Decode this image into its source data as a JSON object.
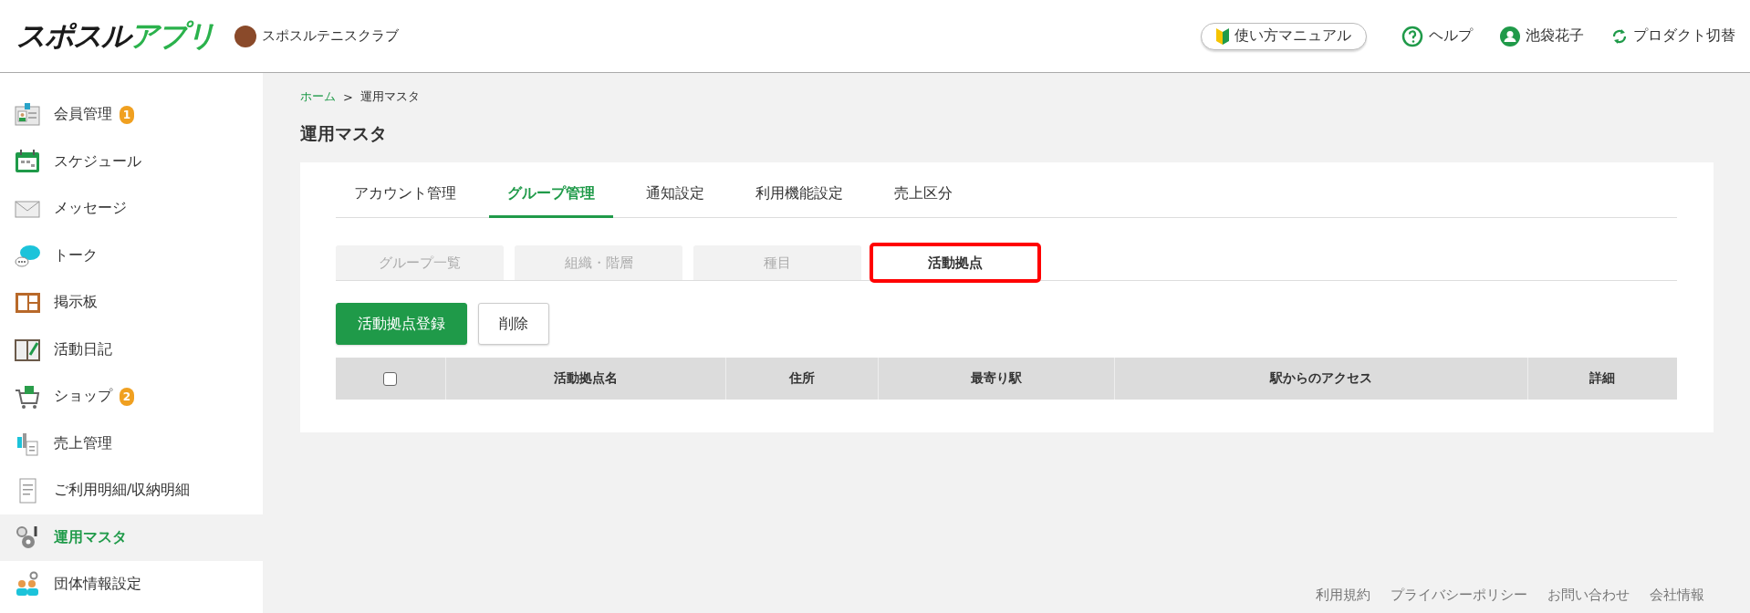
{
  "header": {
    "logo": {
      "part_1": "スポスル",
      "part_2": "アプリ"
    },
    "club_name": "スポスルテニスクラブ",
    "manual_button": "使い方マニュアル",
    "help": "ヘルプ",
    "user_name": "池袋花子",
    "product_switch": "プロダクト切替"
  },
  "sidebar": {
    "items": [
      {
        "kind": "member",
        "label": "会員管理",
        "badge": "1",
        "selected": false
      },
      {
        "kind": "calendar",
        "label": "スケジュール",
        "selected": false
      },
      {
        "kind": "mail",
        "label": "メッセージ",
        "selected": false
      },
      {
        "kind": "chat",
        "label": "トーク",
        "selected": false
      },
      {
        "kind": "board",
        "label": "掲示板",
        "selected": false
      },
      {
        "kind": "diary",
        "label": "活動日記",
        "selected": false
      },
      {
        "kind": "cart",
        "label": "ショップ",
        "badge": "2",
        "selected": false
      },
      {
        "kind": "sales",
        "label": "売上管理",
        "selected": false
      },
      {
        "kind": "receipt",
        "label": "ご利用明細/収納明細",
        "selected": false
      },
      {
        "kind": "gears",
        "label": "運用マスタ",
        "selected": true
      },
      {
        "kind": "team",
        "label": "団体情報設定",
        "selected": false
      }
    ]
  },
  "breadcrumb": [
    {
      "label": "ホーム",
      "link": true
    },
    {
      "label": ">",
      "link": false
    },
    {
      "label": "運用マスタ",
      "link": false
    }
  ],
  "page_title": "運用マスタ",
  "tabs": [
    {
      "label": "アカウント管理",
      "selected": false
    },
    {
      "label": "グループ管理",
      "selected": true
    },
    {
      "label": "通知設定",
      "selected": false
    },
    {
      "label": "利用機能設定",
      "selected": false
    },
    {
      "label": "売上区分",
      "selected": false
    }
  ],
  "subtabs": [
    {
      "label": "グループ一覧",
      "selected": false,
      "highlighted": false
    },
    {
      "label": "組織・階層",
      "selected": false,
      "highlighted": false
    },
    {
      "label": "種目",
      "selected": false,
      "highlighted": false
    },
    {
      "label": "活動拠点",
      "selected": true,
      "highlighted": true
    }
  ],
  "actions": [
    {
      "kind": "primary",
      "label": "活動拠点登録"
    },
    {
      "kind": "secondary",
      "label": "削除"
    }
  ],
  "table": {
    "select_all_checked": false,
    "columns": [
      "活動拠点名",
      "住所",
      "最寄り駅",
      "駅からのアクセス",
      "詳細"
    ]
  },
  "footer": {
    "links": [
      "利用規約",
      "プライバシーポリシー",
      "お問い合わせ",
      "会社情報"
    ]
  }
}
